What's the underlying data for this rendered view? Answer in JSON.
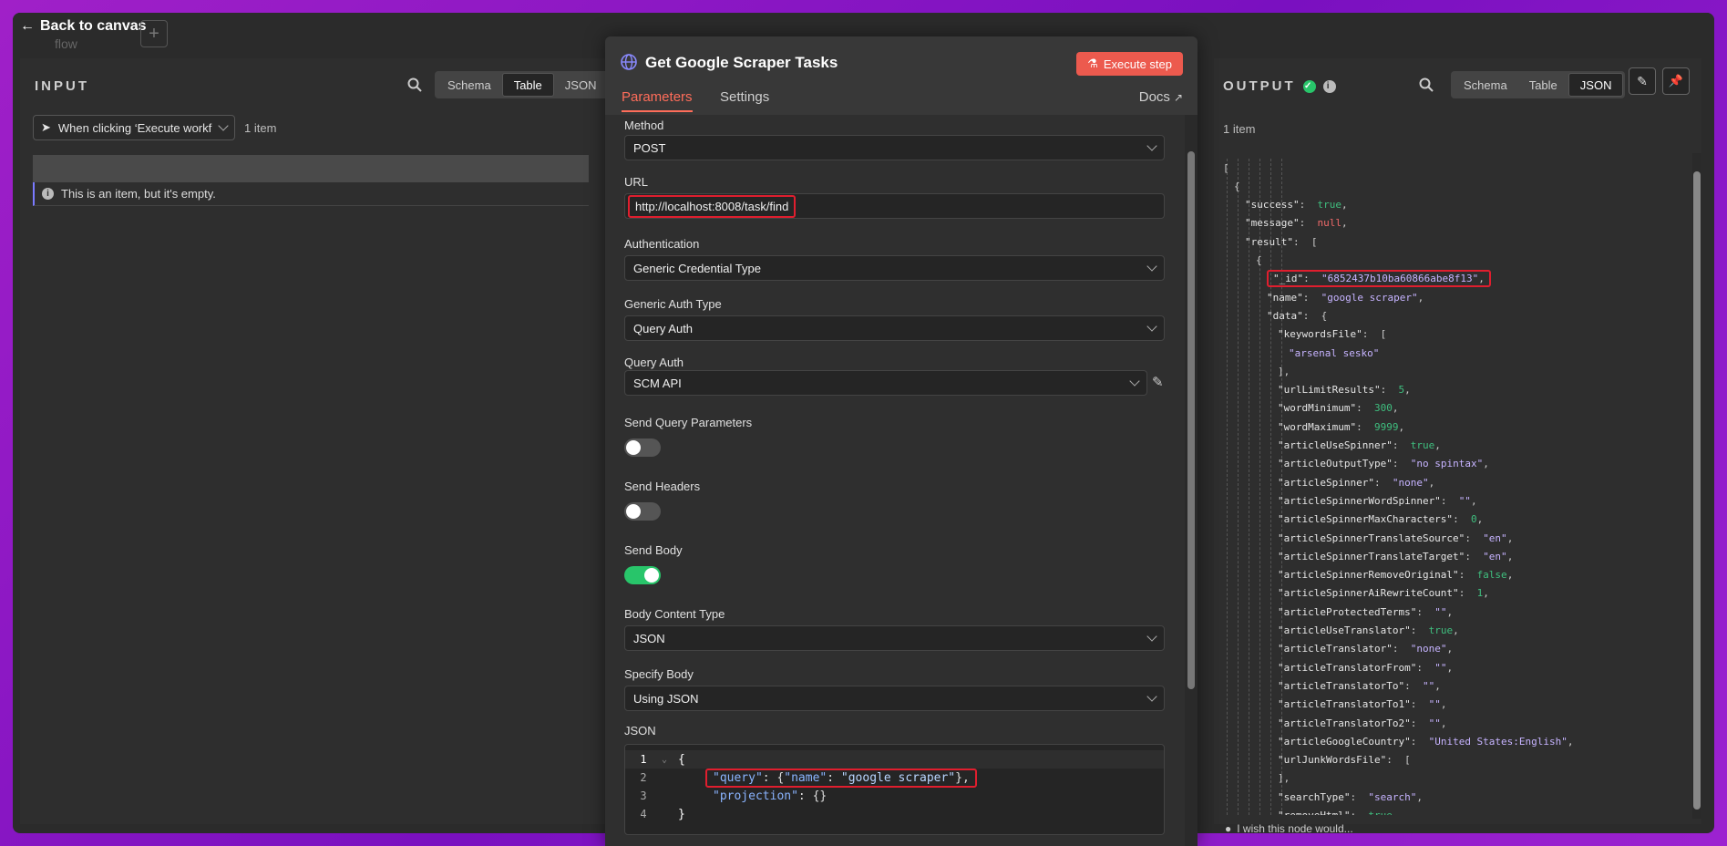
{
  "canvas": {
    "back_label": "Back to canvas",
    "ghost_text": "flow"
  },
  "input": {
    "title": "INPUT",
    "views": [
      "Schema",
      "Table",
      "JSON"
    ],
    "active_view": "Table",
    "trigger_select": "When clicking ‘Execute workfl",
    "count": "1 item",
    "empty_message": "This is an item, but it's empty."
  },
  "node": {
    "title": "Get Google Scraper Tasks",
    "execute_label": "Execute step",
    "tabs": [
      "Parameters",
      "Settings"
    ],
    "docs_label": "Docs",
    "fields": {
      "method_label": "Method",
      "method_value": "POST",
      "url_label": "URL",
      "url_value": "http://localhost:8008/task/find",
      "auth_label": "Authentication",
      "auth_value": "Generic Credential Type",
      "gat_label": "Generic Auth Type",
      "gat_value": "Query Auth",
      "qa_label": "Query Auth",
      "qa_value": "SCM API",
      "sqp_label": "Send Query Parameters",
      "sh_label": "Send Headers",
      "sb_label": "Send Body",
      "bct_label": "Body Content Type",
      "bct_value": "JSON",
      "spec_label": "Specify Body",
      "spec_value": "Using JSON",
      "json_label": "JSON"
    },
    "toggles": {
      "send_query": false,
      "send_headers": false,
      "send_body": true
    },
    "code_lines": [
      {
        "num": "1",
        "text": "{"
      },
      {
        "num": "2",
        "key": "\"query\"",
        "rest": ": {",
        "k2": "\"name\"",
        "colon": ": ",
        "v2": "\"google scraper\"",
        "end": "},"
      },
      {
        "num": "3",
        "key": "\"projection\"",
        "rest": ": {}"
      },
      {
        "num": "4",
        "text": "}"
      }
    ]
  },
  "output": {
    "title": "OUTPUT",
    "views": [
      "Schema",
      "Table",
      "JSON"
    ],
    "active_view": "JSON",
    "count": "1 item",
    "footer_text": "I wish this node would...",
    "json_lines": [
      {
        "d": 0,
        "k": "",
        "v": "[",
        "c": "p"
      },
      {
        "d": 1,
        "k": "",
        "v": "{",
        "c": "p"
      },
      {
        "d": 2,
        "k": "\"success\"",
        "v": "true",
        "c": "t",
        "comma": true
      },
      {
        "d": 2,
        "k": "\"message\"",
        "v": "null",
        "c": "nu",
        "comma": true
      },
      {
        "d": 2,
        "k": "\"result\"",
        "v": "[",
        "c": "p"
      },
      {
        "d": 3,
        "k": "",
        "v": "{",
        "c": "p"
      },
      {
        "d": 4,
        "k": "\"_id\"",
        "v": "\"6852437b10ba60866abe8f13\"",
        "c": "s",
        "comma": true,
        "hl": true
      },
      {
        "d": 4,
        "k": "\"name\"",
        "v": "\"google scraper\"",
        "c": "s",
        "comma": true
      },
      {
        "d": 4,
        "k": "\"data\"",
        "v": "{",
        "c": "p"
      },
      {
        "d": 5,
        "k": "\"keywordsFile\"",
        "v": "[",
        "c": "p"
      },
      {
        "d": 6,
        "k": "",
        "v": "\"arsenal sesko\"",
        "c": "s"
      },
      {
        "d": 5,
        "k": "",
        "v": "],",
        "c": "p"
      },
      {
        "d": 5,
        "k": "\"urlLimitResults\"",
        "v": "5",
        "c": "n",
        "comma": true
      },
      {
        "d": 5,
        "k": "\"wordMinimum\"",
        "v": "300",
        "c": "n",
        "comma": true
      },
      {
        "d": 5,
        "k": "\"wordMaximum\"",
        "v": "9999",
        "c": "n",
        "comma": true
      },
      {
        "d": 5,
        "k": "\"articleUseSpinner\"",
        "v": "true",
        "c": "t",
        "comma": true
      },
      {
        "d": 5,
        "k": "\"articleOutputType\"",
        "v": "\"no spintax\"",
        "c": "s",
        "comma": true
      },
      {
        "d": 5,
        "k": "\"articleSpinner\"",
        "v": "\"none\"",
        "c": "s",
        "comma": true
      },
      {
        "d": 5,
        "k": "\"articleSpinnerWordSpinner\"",
        "v": "\"\"",
        "c": "s",
        "comma": true
      },
      {
        "d": 5,
        "k": "\"articleSpinnerMaxCharacters\"",
        "v": "0",
        "c": "n",
        "comma": true
      },
      {
        "d": 5,
        "k": "\"articleSpinnerTranslateSource\"",
        "v": "\"en\"",
        "c": "s",
        "comma": true
      },
      {
        "d": 5,
        "k": "\"articleSpinnerTranslateTarget\"",
        "v": "\"en\"",
        "c": "s",
        "comma": true
      },
      {
        "d": 5,
        "k": "\"articleSpinnerRemoveOriginal\"",
        "v": "false",
        "c": "t",
        "comma": true
      },
      {
        "d": 5,
        "k": "\"articleSpinnerAiRewriteCount\"",
        "v": "1",
        "c": "n",
        "comma": true
      },
      {
        "d": 5,
        "k": "\"articleProtectedTerms\"",
        "v": "\"\"",
        "c": "s",
        "comma": true
      },
      {
        "d": 5,
        "k": "\"articleUseTranslator\"",
        "v": "true",
        "c": "t",
        "comma": true
      },
      {
        "d": 5,
        "k": "\"articleTranslator\"",
        "v": "\"none\"",
        "c": "s",
        "comma": true
      },
      {
        "d": 5,
        "k": "\"articleTranslatorFrom\"",
        "v": "\"\"",
        "c": "s",
        "comma": true
      },
      {
        "d": 5,
        "k": "\"articleTranslatorTo\"",
        "v": "\"\"",
        "c": "s",
        "comma": true
      },
      {
        "d": 5,
        "k": "\"articleTranslatorTo1\"",
        "v": "\"\"",
        "c": "s",
        "comma": true
      },
      {
        "d": 5,
        "k": "\"articleTranslatorTo2\"",
        "v": "\"\"",
        "c": "s",
        "comma": true
      },
      {
        "d": 5,
        "k": "\"articleGoogleCountry\"",
        "v": "\"United States:English\"",
        "c": "s",
        "comma": true
      },
      {
        "d": 5,
        "k": "\"urlJunkWordsFile\"",
        "v": "[",
        "c": "p"
      },
      {
        "d": 5,
        "k": "",
        "v": "],",
        "c": "p"
      },
      {
        "d": 5,
        "k": "\"searchType\"",
        "v": "\"search\"",
        "c": "s",
        "comma": true
      },
      {
        "d": 5,
        "k": "\"removeHtml\"",
        "v": "true",
        "c": "t",
        "comma": true
      }
    ]
  }
}
